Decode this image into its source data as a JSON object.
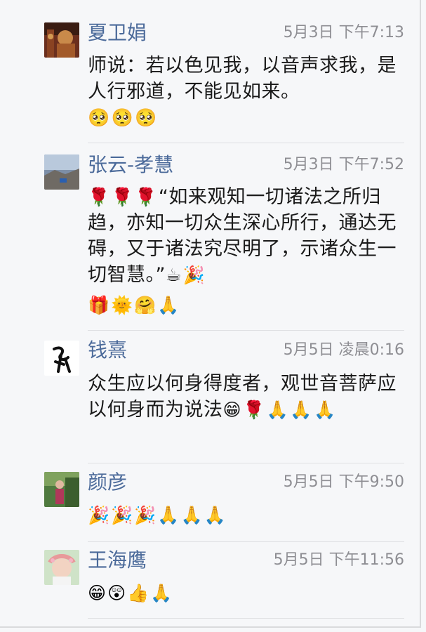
{
  "comments": [
    {
      "name": "夏卫娟",
      "time": "5月3日 下午7:13",
      "text": "师说：若以色见我，以音声求我，是人行邪道，不能见如来。",
      "emojis": [
        "🥺",
        "🥺",
        "🥺"
      ]
    },
    {
      "name": "张云-孝慧",
      "time": "5月3日 下午7:52",
      "text_lead": [
        "🌹",
        "🌹",
        "🌹"
      ],
      "text": "“如来观知一切诸法之所归趋，亦知一切众生深心所行，通达无碍，又于诸法究尽明了，示诸众生一切智慧。”",
      "text_trail": [
        "☕",
        "🎉"
      ],
      "emojis": [
        "🎁",
        "🌞",
        "🤗",
        "🙏"
      ]
    },
    {
      "name": "钱熹",
      "time": "5月5日 凌晨0:16",
      "text": "众生应以何身得度者，观世音菩萨应以何身而为说法",
      "text_trail": [
        "😁",
        "🌹",
        "🙏",
        "🙏",
        "🙏"
      ],
      "emojis": []
    },
    {
      "name": "颜彦",
      "time": "5月5日 下午9:50",
      "emojis": [
        "🎉",
        "🎉",
        "🎉",
        "🙏",
        "🙏",
        "🙏"
      ]
    },
    {
      "name": "王海鹰",
      "time": "5月5日 下午11:56",
      "emojis": [
        "😁",
        "😲",
        "👍",
        "🙏"
      ]
    }
  ]
}
